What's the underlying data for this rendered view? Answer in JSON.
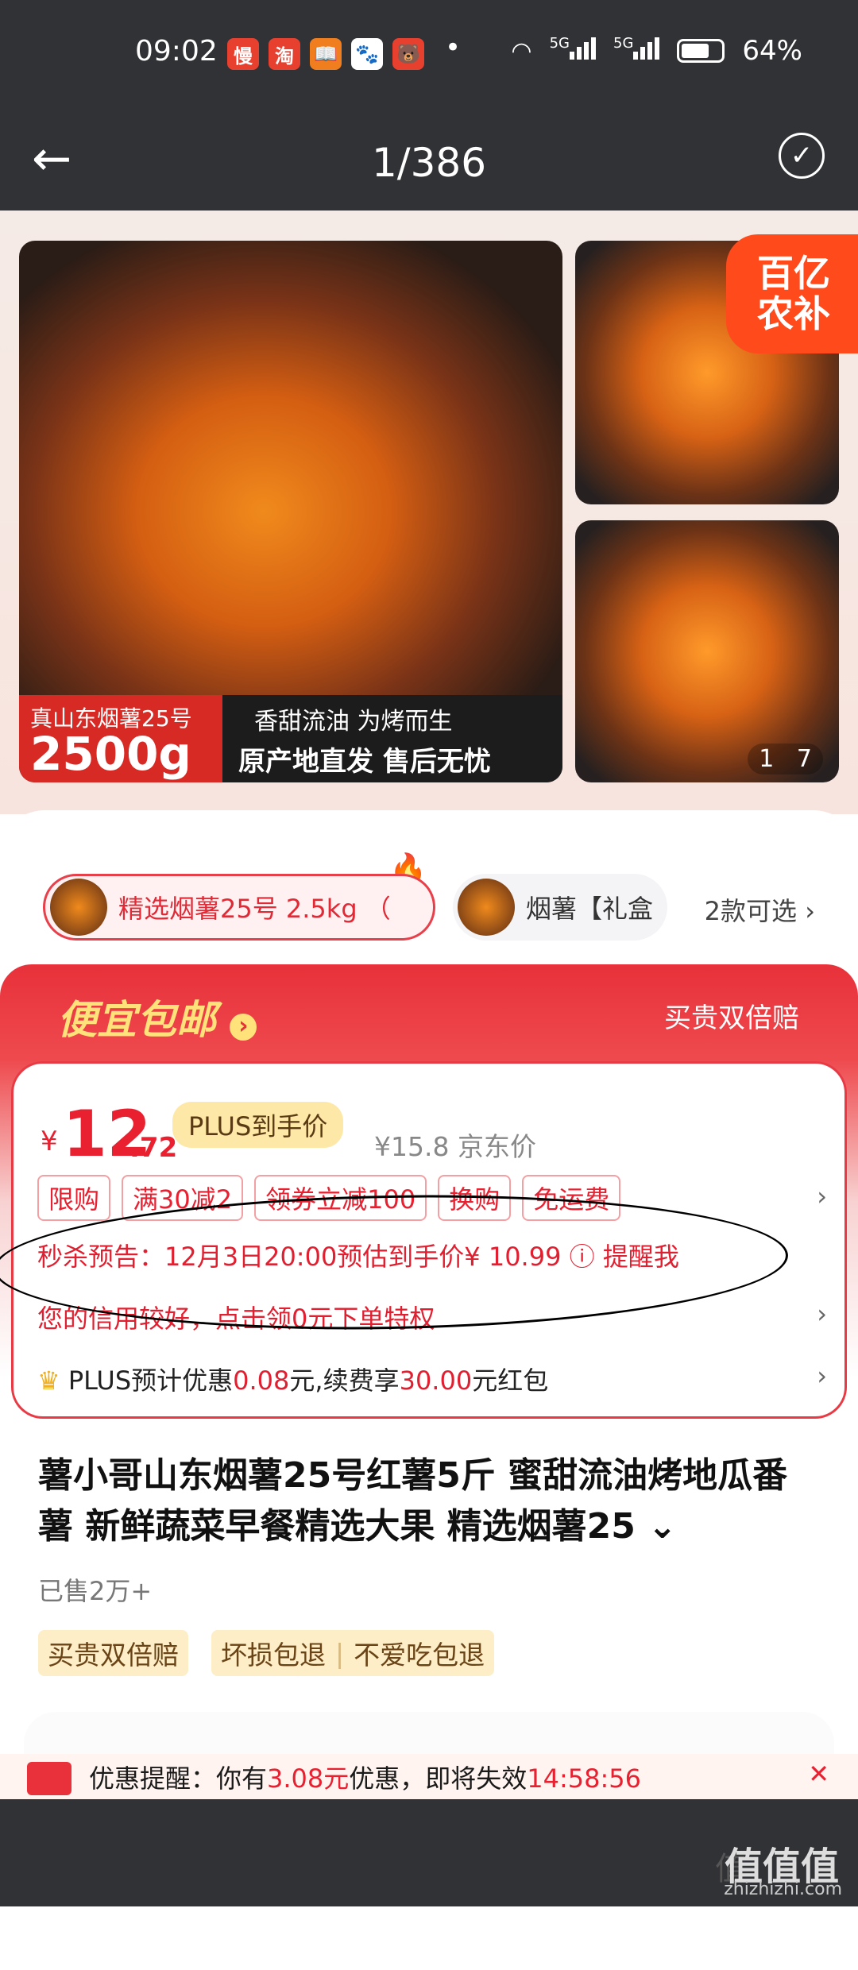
{
  "status": {
    "time": "09:02",
    "app_icons": [
      "慢",
      "淘",
      "📖",
      "🐾",
      "🐻"
    ],
    "dot": "•",
    "battery": "64%",
    "signal1": "5G",
    "signal2": "5G"
  },
  "viewer": {
    "counter": "1/386"
  },
  "media": {
    "banner_a": "真山东烟薯25号",
    "banner_b": "2500g",
    "banner_c": "香甜流油 为烤而生",
    "banner_d": "原产地直发 售后无忧",
    "badge": "百亿\n农补",
    "pager_current": "1",
    "pager_total": "7"
  },
  "skus": {
    "selected": "精选烟薯25号 2.5kg （",
    "other": "烟薯【礼盒",
    "more": "2款可选"
  },
  "promo": {
    "title": "便宜包邮",
    "title_arrow": "›",
    "right": "买贵双倍赔"
  },
  "price": {
    "currency": "¥",
    "integer": "12",
    "decimal": ".72",
    "plus_label": "PLUS到手价",
    "jd_price": "¥15.8",
    "jd_label": "京东价",
    "tags": [
      "限购",
      "满30减2",
      "领券立减100",
      "换购",
      "免运费"
    ],
    "flash": "秒杀预告：12月3日20:00预估到手价¥ 10.99",
    "flash_icon": "ⓘ",
    "remind": "提醒我",
    "credit": "您的信用较好，点击领0元下单特权",
    "plus_a": "PLUS预计优惠",
    "plus_v1": "0.08",
    "plus_b": "元,续费享",
    "plus_v2": "30.00",
    "plus_c": "元红包"
  },
  "product": {
    "title": "薯小哥山东烟薯25号红薯5斤 蜜甜流油烤地瓜番薯 新鲜蔬菜早餐精选大果 精选烟薯25",
    "sold": "已售2万+",
    "guarantees": [
      "买贵双倍赔",
      "坏损包退",
      "不爱吃包退"
    ]
  },
  "notice": {
    "a": "优惠提醒：你有",
    "amount": "3.08元",
    "b": "优惠，即将失效",
    "timer": "14:58:56",
    "close": "✕"
  },
  "watermark": {
    "a": "值",
    "b": "值值值",
    "c": "zhizhizhi.com"
  }
}
